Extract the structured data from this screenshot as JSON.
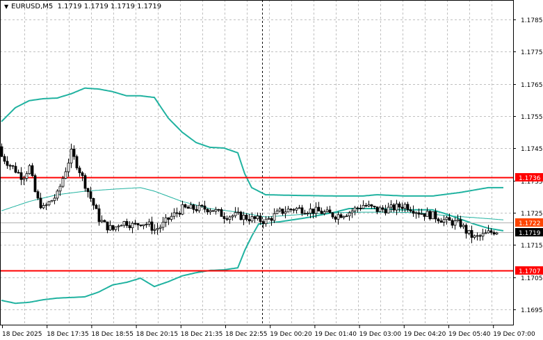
{
  "header": {
    "symbol": "EURUSD,M5",
    "ohlc": "1.1719 1.1719 1.1719 1.1719"
  },
  "colors": {
    "bands": "#20b2a0",
    "level": "#ff0000",
    "bid": "#000000",
    "ask": "#ff4500",
    "grid": "#c0c0c0"
  },
  "price_axis": {
    "ticks": [
      "1.1785",
      "1.1775",
      "1.1765",
      "1.1755",
      "1.1745",
      "1.1735",
      "1.1725",
      "1.1715",
      "1.1705",
      "1.1695"
    ],
    "tags": [
      {
        "label": "1.1736",
        "price": 1.1736,
        "kind": "level"
      },
      {
        "label": "1.1707",
        "price": 1.1707,
        "kind": "level"
      },
      {
        "label": "1.1722",
        "price": 1.1722,
        "kind": "ask"
      },
      {
        "label": "1.1719",
        "price": 1.1719,
        "kind": "bid"
      }
    ]
  },
  "time_axis": {
    "labels": [
      "18 Dec 2025",
      "18 Dec 17:35",
      "18 Dec 18:55",
      "18 Dec 20:15",
      "18 Dec 21:35",
      "18 Dec 22:55",
      "19 Dec 00:20",
      "19 Dec 01:40",
      "19 Dec 03:00",
      "19 Dec 04:20",
      "19 Dec 05:40",
      "19 Dec 07:00"
    ]
  },
  "chart_data": {
    "type": "candlestick",
    "ylim": [
      1.169,
      1.1791
    ],
    "bars": 180,
    "close_keypoints": {
      "bar": [
        0,
        2.5,
        5,
        7.5,
        10,
        12.5,
        15,
        17.5,
        20,
        22.5,
        25,
        27.5,
        30,
        32.5,
        35,
        37.5,
        40,
        42.5,
        45,
        47.5,
        50,
        52.5,
        55,
        57.5,
        60,
        65,
        70,
        75,
        80,
        85,
        90,
        95,
        100,
        105,
        110,
        115,
        120,
        125,
        130,
        135,
        140,
        145,
        150,
        155,
        160,
        165,
        167.5,
        170,
        172.5,
        175,
        177.5
      ],
      "price": [
        1.17425,
        1.17403,
        1.17382,
        1.1736,
        1.17392,
        1.17295,
        1.17263,
        1.17285,
        1.17306,
        1.17371,
        1.17436,
        1.17392,
        1.17338,
        1.17285,
        1.17231,
        1.17209,
        1.17198,
        1.1722,
        1.1722,
        1.17209,
        1.1722,
        1.17215,
        1.17198,
        1.17209,
        1.17231,
        1.17263,
        1.17263,
        1.17263,
        1.17241,
        1.17241,
        1.17231,
        1.17224,
        1.17252,
        1.17263,
        1.17259,
        1.17252,
        1.17241,
        1.17252,
        1.17274,
        1.17259,
        1.17263,
        1.17274,
        1.17252,
        1.17241,
        1.17224,
        1.17215,
        1.17187,
        1.17172,
        1.17177,
        1.17187,
        1.17194
      ]
    },
    "bollinger": {
      "upper": {
        "bar": [
          0,
          5,
          10,
          15,
          20,
          25,
          30,
          35,
          40,
          45,
          50,
          55,
          60,
          65,
          70,
          75,
          80,
          85,
          87.5,
          90,
          95,
          105,
          120,
          130,
          135,
          145,
          155,
          165,
          175,
          180.5
        ],
        "price": [
          1.17533,
          1.17576,
          1.17598,
          1.17604,
          1.17606,
          1.17619,
          1.17637,
          1.17634,
          1.17626,
          1.17613,
          1.17613,
          1.17608,
          1.17544,
          1.175,
          1.17468,
          1.17453,
          1.17451,
          1.17436,
          1.17371,
          1.17328,
          1.17306,
          1.17304,
          1.17302,
          1.17302,
          1.17306,
          1.17302,
          1.17302,
          1.17313,
          1.17328,
          1.17328
        ]
      },
      "middle": {
        "bar": [
          0,
          10,
          20,
          30,
          40,
          50,
          55,
          65,
          75,
          85,
          95,
          110,
          120,
          130,
          140,
          150,
          160,
          170,
          180.5
        ],
        "price": [
          1.17256,
          1.17285,
          1.17306,
          1.17317,
          1.17323,
          1.17328,
          1.17317,
          1.17285,
          1.17263,
          1.17252,
          1.17237,
          1.17246,
          1.1725,
          1.17252,
          1.17252,
          1.1725,
          1.17241,
          1.17235,
          1.17228
        ]
      },
      "lower": {
        "bar": [
          0,
          5,
          10,
          15,
          20,
          25,
          30,
          35,
          40,
          45,
          50,
          55,
          60,
          65,
          70,
          75,
          80,
          85,
          87.5,
          90,
          92.5,
          100,
          110,
          120,
          125,
          135,
          145,
          155,
          160,
          170,
          175,
          180.5
        ],
        "price": [
          1.16978,
          1.16969,
          1.16972,
          1.1698,
          1.16985,
          1.16987,
          1.16989,
          1.17004,
          1.17026,
          1.17034,
          1.17047,
          1.17021,
          1.17036,
          1.17054,
          1.17064,
          1.17071,
          1.17073,
          1.17079,
          1.17133,
          1.17177,
          1.17215,
          1.17222,
          1.17235,
          1.17252,
          1.17263,
          1.17263,
          1.17259,
          1.17259,
          1.17246,
          1.17215,
          1.17202,
          1.17194
        ]
      }
    },
    "levels": [
      1.1736,
      1.1707
    ],
    "vertical_marker_bar": 93.75
  }
}
